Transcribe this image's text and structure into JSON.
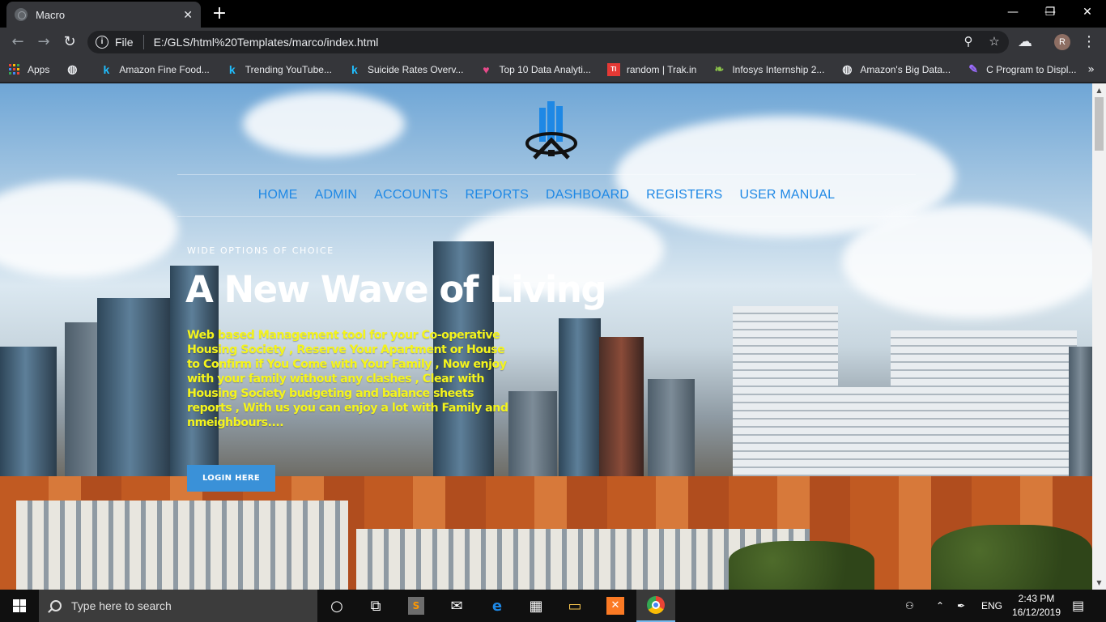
{
  "browser": {
    "tab_title": "Macro",
    "tab_close": "✕",
    "new_tab": "+",
    "window_controls": [
      "—",
      "❐",
      "✕"
    ],
    "address_scheme": "File",
    "address_url": "E:/GLS/html%20Templates/marco/index.html",
    "profile_initial": "R",
    "bookmarks": [
      {
        "label": "Apps",
        "icon": "apps-grid-icon"
      },
      {
        "label": "",
        "icon": "globe-icon"
      },
      {
        "label": "Amazon Fine Food...",
        "icon": "kaggle-icon"
      },
      {
        "label": "Trending YouTube...",
        "icon": "kaggle-icon"
      },
      {
        "label": "Suicide Rates Overv...",
        "icon": "kaggle-icon"
      },
      {
        "label": "Top 10 Data Analyti...",
        "icon": "heart-icon"
      },
      {
        "label": "random | Trak.in",
        "icon": "trakin-icon"
      },
      {
        "label": "Infosys Internship 2...",
        "icon": "leaf-icon"
      },
      {
        "label": "Amazon's Big Data...",
        "icon": "globe-icon"
      },
      {
        "label": "C Program to Displ...",
        "icon": "pencil-icon"
      }
    ],
    "bookmarks_more": "»"
  },
  "site": {
    "nav": [
      "HOME",
      "ADMIN",
      "ACCOUNTS",
      "REPORTS",
      "DASHBOARD",
      "REGISTERS",
      "USER MANUAL"
    ],
    "eyebrow": "WIDE OPTIONS OF CHOICE",
    "headline": "A New Wave of Living",
    "description": "Web based Management tool for your Co-operative Housing Society , Reserve Your Apartment or House to Confirm if You Come with Your Family , Now enjoy with your family without any clashes , Clear with Housing Society budgeting and balance sheets reports , With us you can enjoy a lot with Family and nmeighbours....",
    "login_button": "LOGIN HERE",
    "colors": {
      "nav": "#1e88e5",
      "description": "#f4f41c",
      "button": "#3a91d8"
    }
  },
  "taskbar": {
    "search_placeholder": "Type here to search",
    "language": "ENG",
    "time": "2:43 PM",
    "date": "16/12/2019"
  }
}
